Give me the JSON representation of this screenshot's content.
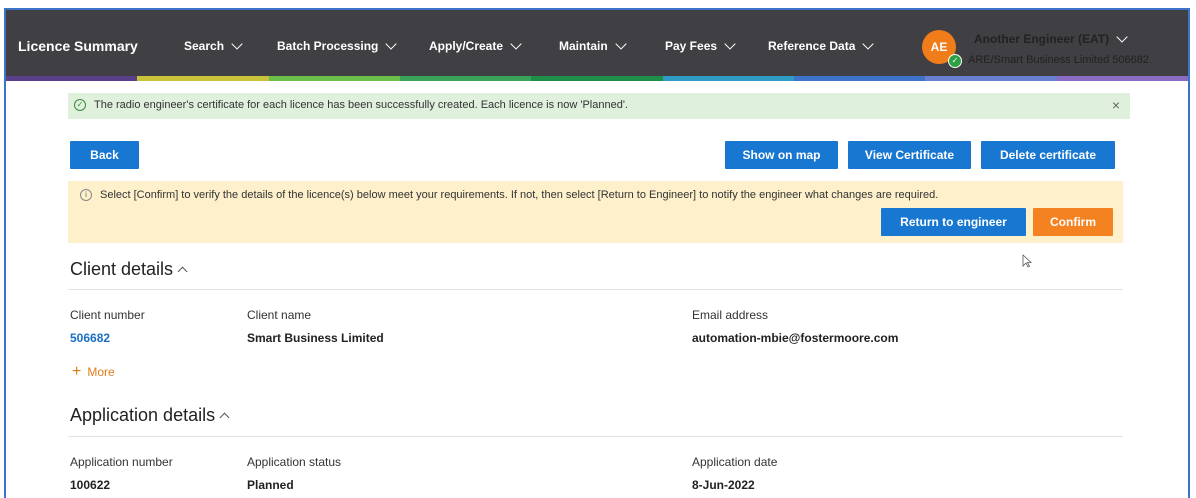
{
  "nav": {
    "brand": "Licence Summary",
    "items": [
      "Search",
      "Batch Processing",
      "Apply/Create",
      "Maintain",
      "Pay Fees",
      "Reference Data"
    ],
    "user": {
      "initials": "AE",
      "name": "Another Engineer (EAT)",
      "org": "ARE/Smart Business Limited 506682"
    }
  },
  "success_banner": {
    "message": "The radio engineer's certificate for each licence has been successfully created. Each licence is now 'Planned'.",
    "close": "×"
  },
  "buttons": {
    "back": "Back",
    "show_on_map": "Show on map",
    "view_certificate": "View Certificate",
    "delete_certificate": "Delete certificate",
    "return_to_engineer": "Return to engineer",
    "confirm": "Confirm"
  },
  "warning": {
    "message": "Select [Confirm] to verify the details of the licence(s) below meet your requirements. If not, then select [Return to Engineer] to notify the engineer what changes are required."
  },
  "client": {
    "title": "Client details",
    "number_label": "Client number",
    "number": "506682",
    "name_label": "Client name",
    "name": "Smart Business Limited",
    "email_label": "Email address",
    "email": "automation-mbie@fostermoore.com",
    "more": "More"
  },
  "application": {
    "title": "Application details",
    "number_label": "Application number",
    "number": "100622",
    "status_label": "Application status",
    "status": "Planned",
    "date_label": "Application date",
    "date": "8-Jun-2022"
  },
  "colors": {
    "nav_bg": "#3f3f44",
    "primary": "#1877d0",
    "accent": "#f58220",
    "success_bg": "#dff0dc",
    "warning_bg": "#fdf0cb"
  }
}
